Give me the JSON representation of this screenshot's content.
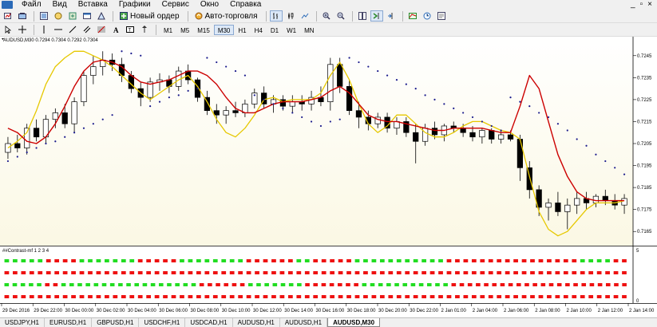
{
  "menu": {
    "items": [
      "Файл",
      "Вид",
      "Вставка",
      "Графики",
      "Сервис",
      "Окно",
      "Справка"
    ],
    "window_controls": [
      "_",
      "▫",
      "×"
    ]
  },
  "toolbar": {
    "new_order_label": "Новый ордер",
    "autotrade_label": "Авто-торговля",
    "timeframes": [
      "M1",
      "M5",
      "M15",
      "M30",
      "H1",
      "H4",
      "D1",
      "W1",
      "MN"
    ],
    "active_timeframe": "M30"
  },
  "chart": {
    "header": "AUDUSD,M30  0.7294 0.7304 0.7292 0.7304",
    "indicator_label": "##Contrast-mf 1 2 3 4",
    "colors": {
      "bull": "#000000",
      "bear": "#000000",
      "ma_red": "#cc0000",
      "band_yellow": "#e6c800",
      "sar": "#1a1a8c",
      "signal_green": "#22dd22",
      "signal_red": "#ee1111",
      "bg_top": "#ffffff",
      "bg_bottom": "#fbf8e4"
    }
  },
  "chart_data": {
    "type": "candlestick",
    "symbol": "AUDUSD",
    "timeframe": "M30",
    "price_ticks": [
      "0.7245",
      "0.7235",
      "0.7225",
      "0.7215",
      "0.7205",
      "0.7195",
      "0.7185",
      "0.7175",
      "0.7165"
    ],
    "ylim": [
      0.716,
      0.725
    ],
    "indicator_axis": [
      "5",
      "0"
    ],
    "time_ticks": [
      "29 Dec 2016",
      "29 Dec 22:00",
      "30 Dec 00:00",
      "30 Dec 02:00",
      "30 Dec 04:00",
      "30 Dec 06:00",
      "30 Dec 08:00",
      "30 Dec 10:00",
      "30 Dec 12:00",
      "30 Dec 14:00",
      "30 Dec 16:00",
      "30 Dec 18:00",
      "30 Dec 20:00",
      "30 Dec 22:00",
      "2 Jan 01:00",
      "2 Jan 04:00",
      "2 Jan 06:00",
      "2 Jan 08:00",
      "2 Jan 10:00",
      "2 Jan 12:00",
      "2 Jan 14:00"
    ],
    "candles": [
      [
        0.7201,
        0.7208,
        0.7198,
        0.7205
      ],
      [
        0.7205,
        0.7209,
        0.7201,
        0.7203
      ],
      [
        0.7203,
        0.7214,
        0.72,
        0.7212
      ],
      [
        0.7212,
        0.7216,
        0.7206,
        0.7208
      ],
      [
        0.7208,
        0.7218,
        0.7205,
        0.7216
      ],
      [
        0.7216,
        0.7221,
        0.7212,
        0.7219
      ],
      [
        0.7219,
        0.7223,
        0.7212,
        0.7214
      ],
      [
        0.7214,
        0.7226,
        0.721,
        0.7224
      ],
      [
        0.7224,
        0.7238,
        0.7222,
        0.7236
      ],
      [
        0.7236,
        0.7245,
        0.7232,
        0.724
      ],
      [
        0.724,
        0.7247,
        0.7236,
        0.7243
      ],
      [
        0.7243,
        0.7246,
        0.7238,
        0.7241
      ],
      [
        0.7241,
        0.7244,
        0.7233,
        0.7236
      ],
      [
        0.7236,
        0.7238,
        0.7228,
        0.723
      ],
      [
        0.723,
        0.7233,
        0.7222,
        0.7226
      ],
      [
        0.7226,
        0.7235,
        0.7224,
        0.7233
      ],
      [
        0.7233,
        0.7237,
        0.7229,
        0.7234
      ],
      [
        0.7234,
        0.7236,
        0.7228,
        0.7231
      ],
      [
        0.7231,
        0.724,
        0.7229,
        0.7238
      ],
      [
        0.7238,
        0.7241,
        0.7232,
        0.7234
      ],
      [
        0.7234,
        0.7235,
        0.7224,
        0.7226
      ],
      [
        0.7226,
        0.7229,
        0.7218,
        0.722
      ],
      [
        0.722,
        0.7223,
        0.7214,
        0.7218
      ],
      [
        0.7218,
        0.7222,
        0.7214,
        0.722
      ],
      [
        0.722,
        0.7224,
        0.7217,
        0.7219
      ],
      [
        0.7219,
        0.7225,
        0.7217,
        0.7223
      ],
      [
        0.7223,
        0.723,
        0.7221,
        0.7228
      ],
      [
        0.7228,
        0.7231,
        0.7221,
        0.7223
      ],
      [
        0.7223,
        0.7227,
        0.7219,
        0.7225
      ],
      [
        0.7225,
        0.7227,
        0.722,
        0.7222
      ],
      [
        0.7222,
        0.7227,
        0.7219,
        0.7224
      ],
      [
        0.7224,
        0.7227,
        0.722,
        0.7223
      ],
      [
        0.7223,
        0.7229,
        0.722,
        0.7226
      ],
      [
        0.7226,
        0.7231,
        0.7222,
        0.7224
      ],
      [
        0.7224,
        0.7244,
        0.722,
        0.7241
      ],
      [
        0.7241,
        0.7244,
        0.7228,
        0.7231
      ],
      [
        0.7231,
        0.7234,
        0.7218,
        0.722
      ],
      [
        0.722,
        0.7224,
        0.7212,
        0.7217
      ],
      [
        0.7217,
        0.722,
        0.7211,
        0.7214
      ],
      [
        0.7214,
        0.7219,
        0.7212,
        0.7217
      ],
      [
        0.7217,
        0.7219,
        0.721,
        0.7212
      ],
      [
        0.7212,
        0.7217,
        0.7209,
        0.7215
      ],
      [
        0.7215,
        0.7217,
        0.7208,
        0.721
      ],
      [
        0.721,
        0.7214,
        0.7196,
        0.7206
      ],
      [
        0.7206,
        0.7214,
        0.7204,
        0.7212
      ],
      [
        0.7212,
        0.7215,
        0.7207,
        0.7209
      ],
      [
        0.7209,
        0.7214,
        0.7206,
        0.7213
      ],
      [
        0.7213,
        0.7215,
        0.721,
        0.7212
      ],
      [
        0.7212,
        0.7214,
        0.7208,
        0.721
      ],
      [
        0.721,
        0.7213,
        0.7206,
        0.7208
      ],
      [
        0.7208,
        0.7212,
        0.7205,
        0.7211
      ],
      [
        0.7211,
        0.7212,
        0.7205,
        0.7207
      ],
      [
        0.7207,
        0.7211,
        0.7205,
        0.7209
      ],
      [
        0.7209,
        0.7211,
        0.7206,
        0.7207
      ],
      [
        0.7207,
        0.7209,
        0.7188,
        0.7194
      ],
      [
        0.7194,
        0.7197,
        0.718,
        0.7184
      ],
      [
        0.7184,
        0.7186,
        0.7172,
        0.7176
      ],
      [
        0.7176,
        0.718,
        0.717,
        0.7178
      ],
      [
        0.7178,
        0.7183,
        0.7172,
        0.7174
      ],
      [
        0.7174,
        0.718,
        0.7166,
        0.7177
      ],
      [
        0.7177,
        0.7183,
        0.7173,
        0.718
      ],
      [
        0.718,
        0.7183,
        0.7175,
        0.7178
      ],
      [
        0.7178,
        0.7182,
        0.7176,
        0.7181
      ],
      [
        0.7181,
        0.7184,
        0.7177,
        0.7179
      ],
      [
        0.7179,
        0.7182,
        0.7175,
        0.7177
      ],
      [
        0.7177,
        0.7182,
        0.7173,
        0.718
      ]
    ],
    "ma_red": [
      0.7212,
      0.721,
      0.7206,
      0.7205,
      0.7208,
      0.7214,
      0.7222,
      0.7231,
      0.7238,
      0.7242,
      0.7243,
      0.7242,
      0.724,
      0.7236,
      0.7233,
      0.7232,
      0.7233,
      0.7234,
      0.7236,
      0.7238,
      0.7238,
      0.7236,
      0.7232,
      0.7226,
      0.7221,
      0.7219,
      0.7219,
      0.7221,
      0.7223,
      0.7224,
      0.7224,
      0.7224,
      0.7225,
      0.7226,
      0.7229,
      0.7231,
      0.7228,
      0.7223,
      0.7218,
      0.7216,
      0.7215,
      0.7215,
      0.7214,
      0.7213,
      0.7212,
      0.7211,
      0.7211,
      0.7212,
      0.7212,
      0.7212,
      0.7212,
      0.7211,
      0.721,
      0.721,
      0.7222,
      0.7236,
      0.723,
      0.7215,
      0.72,
      0.719,
      0.7183,
      0.718,
      0.7179,
      0.7179,
      0.7179,
      0.7179
    ],
    "band_yellow": [
      0.7203,
      0.7206,
      0.721,
      0.722,
      0.7232,
      0.724,
      0.7244,
      0.7247,
      0.7247,
      0.7245,
      0.7243,
      0.724,
      0.7236,
      0.7232,
      0.7228,
      0.7225,
      0.7228,
      0.7231,
      0.7234,
      0.7236,
      0.7231,
      0.7224,
      0.7216,
      0.721,
      0.7208,
      0.7212,
      0.7218,
      0.7225,
      0.7226,
      0.7224,
      0.7225,
      0.7225,
      0.7225,
      0.7228,
      0.7236,
      0.7242,
      0.7234,
      0.7223,
      0.7214,
      0.721,
      0.7213,
      0.7218,
      0.7218,
      0.7214,
      0.721,
      0.7208,
      0.7208,
      0.721,
      0.7213,
      0.7215,
      0.7215,
      0.7213,
      0.7211,
      0.721,
      0.7207,
      0.719,
      0.7174,
      0.7166,
      0.7163,
      0.7165,
      0.717,
      0.7175,
      0.7178,
      0.7178,
      0.7178,
      0.7179
    ],
    "sar": [
      0.7197,
      0.7199,
      0.7201,
      0.7203,
      0.7205,
      0.7206,
      0.7208,
      0.721,
      0.7212,
      0.7214,
      0.7216,
      0.7218,
      0.7247,
      0.7246,
      0.7245,
      0.7222,
      0.7224,
      0.7226,
      0.7227,
      0.7229,
      0.723,
      0.7244,
      0.7242,
      0.724,
      0.7238,
      0.7236,
      0.7227,
      0.7225,
      0.7223,
      0.7221,
      0.7219,
      0.7217,
      0.7215,
      0.7213,
      0.7215,
      0.7216,
      0.7244,
      0.7242,
      0.724,
      0.7238,
      0.7236,
      0.7234,
      0.7232,
      0.723,
      0.7227,
      0.7225,
      0.7223,
      0.7221,
      0.7219,
      0.7217,
      0.7215,
      0.7213,
      0.7211,
      0.7226,
      0.7224,
      0.7222,
      0.7219,
      0.7217,
      0.7214,
      0.7211,
      0.7207,
      0.7204,
      0.72,
      0.7197,
      0.7194,
      0.7191
    ],
    "signal_rows": [
      "GGGGGRRRRGGGGGGGRRRRRGGGGGGGGRRRRRRGGRRRRRGGGGGGGGGGGRRRRRRRRRRRRRRRRGGGGRR",
      "RRRRRRRRRRRRRRRRRRRRRRRRRRRRRRRRRRRRRRRRRRRRRRRRRRRRRRRRRRRRRRRRRRRRRRRRRRR",
      "GGGGGRRGGGGGGGGGGGGGGGGGRRRRRRGGGGGGGRRRRRRRGGGGGGGGGGGRRRRRRRRRRRRRRRRRRRRRR",
      "RRRRRRRRRRRRRRRRRRRRRRRRRRRRRRRRRRRRRRRRRRRRRRRRRRRRRRRRRRRRRRRRRRRRRRRRRRR"
    ]
  },
  "tabs": {
    "items": [
      "USDJPY,H1",
      "EURUSD,H1",
      "GBPUSD,H1",
      "USDCHF,H1",
      "USDCAD,H1",
      "AUDUSD,H1",
      "AUDUSD,H1",
      "AUDUSD,M30"
    ],
    "active_index": 7
  }
}
